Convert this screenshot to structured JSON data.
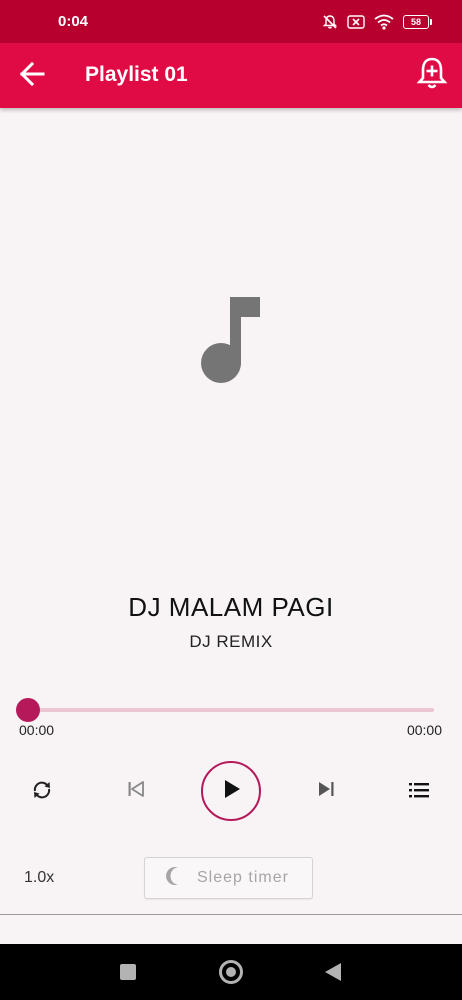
{
  "status_bar": {
    "time": "0:04",
    "battery": "58",
    "icons": [
      "mute-bell-icon",
      "close-box-icon",
      "wifi-icon",
      "battery-icon"
    ]
  },
  "app_bar": {
    "title": "Playlist 01",
    "back_icon": "arrow-back-icon",
    "action_icon": "add-alarm-icon"
  },
  "artwork": {
    "icon": "music-note-icon",
    "color": "#757575"
  },
  "track": {
    "title": "DJ MALAM PAGI",
    "artist": "DJ REMIX"
  },
  "progress": {
    "elapsed": "00:00",
    "total": "00:00",
    "fraction": 0
  },
  "controls": {
    "repeat_icon": "repeat-icon",
    "previous_icon": "skip-previous-icon",
    "play_icon": "play-icon",
    "next_icon": "skip-next-icon",
    "queue_icon": "queue-list-icon"
  },
  "options": {
    "speed": "1.0x",
    "sleep_timer": "Sleep timer",
    "sleep_icon": "moon-icon"
  },
  "colors": {
    "status_bar": "#b8002f",
    "app_bar": "#e00a45",
    "accent": "#b5195a",
    "track_background": "#e9c6d2",
    "background": "#f8f4f5"
  }
}
